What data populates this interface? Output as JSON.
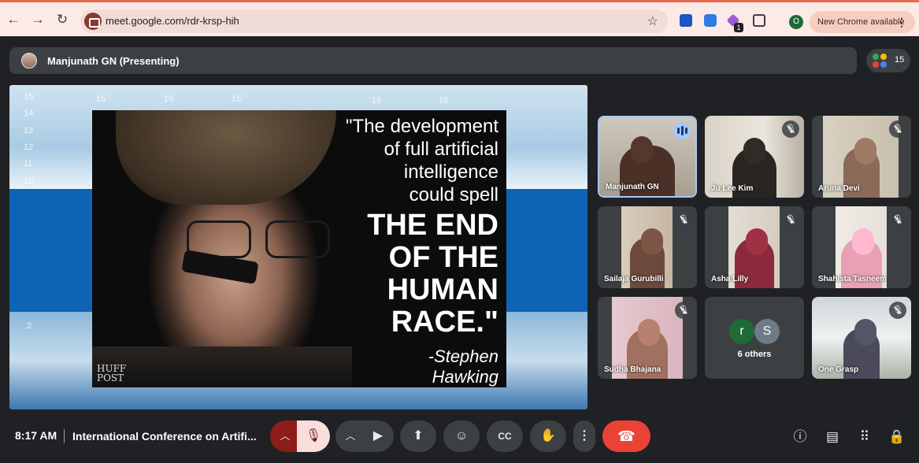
{
  "browser": {
    "url": "meet.google.com/rdr-krsp-hih",
    "extension_badge": "1",
    "profile_initial": "O",
    "update_label": "New Chrome available"
  },
  "presenter": {
    "label": "Manjunath GN (Presenting)"
  },
  "participants_count": "15",
  "slide": {
    "quote_lines_small": [
      "\"The development",
      "of full artificial",
      "intelligence",
      "could spell"
    ],
    "quote_lines_big": [
      "THE END",
      "OF THE",
      "HUMAN",
      "RACE.\""
    ],
    "author_lines": [
      "-Stephen",
      "Hawking"
    ],
    "logo_lines": [
      "HUFF",
      "POST"
    ],
    "ruler_ticks": [
      "15",
      "14",
      "13",
      "12",
      "11",
      "10",
      "2"
    ]
  },
  "tiles": [
    {
      "name": "Manjunath GN",
      "state": "speaking"
    },
    {
      "name": "Ju Lee Kim",
      "state": "muted"
    },
    {
      "name": "Aruna Devi",
      "state": "muted"
    },
    {
      "name": "Sailaja Gurubilli",
      "state": "muted"
    },
    {
      "name": "Asha Lilly",
      "state": "muted"
    },
    {
      "name": "Shahista Tasneem",
      "state": "muted"
    },
    {
      "name": "Sudha Bhajana",
      "state": "muted"
    },
    {
      "name": "6 others",
      "state": "group",
      "avatars": [
        "r",
        "S"
      ]
    },
    {
      "name": "One Grasp",
      "state": "muted"
    }
  ],
  "bottom": {
    "time": "8:17 AM",
    "meeting_title": "International Conference on Artifi..."
  },
  "colors": {
    "chrome_frame": "#fbeae6",
    "meet_bg": "#202124",
    "tile_bg": "#3c4043",
    "end_call": "#ea4335",
    "active_outline": "#a8c7fa"
  }
}
